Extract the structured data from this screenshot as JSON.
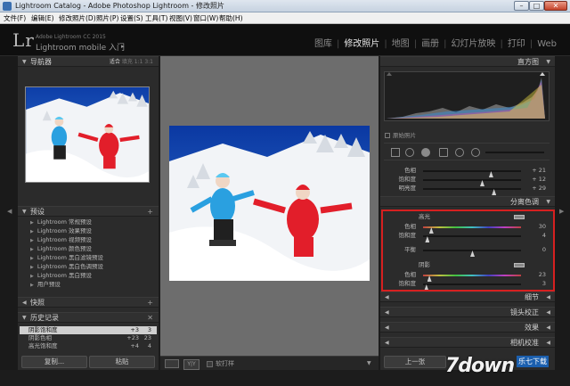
{
  "window": {
    "title": "Lightroom Catalog - Adobe Photoshop Lightroom - 修改照片",
    "min": "–",
    "max": "□",
    "close": "✕"
  },
  "menu": [
    "文件(F)",
    "编辑(E)",
    "修改照片(D)",
    "照片(P)",
    "设置(S)",
    "工具(T)",
    "视图(V)",
    "窗口(W)",
    "帮助(H)"
  ],
  "identity": {
    "logo": "Lr",
    "product": "Adobe Lightroom CC 2015",
    "mobile": "Lightroom mobile 入门",
    "arrow": "▸"
  },
  "modules": [
    "图库",
    "修改照片",
    "地图",
    "画册",
    "幻灯片放映",
    "打印",
    "Web"
  ],
  "active_module": "修改照片",
  "left": {
    "navigator": {
      "label": "导航器",
      "opts": [
        "适合",
        "填充",
        "1:1",
        "3:1"
      ]
    },
    "presets_label": "预设",
    "presets": [
      "Lightroom 常规预设",
      "Lightroom 效果预设",
      "Lightroom 视频预设",
      "Lightroom 颜色预设",
      "Lightroom 黑白滤镜预设",
      "Lightroom 黑白色调预设",
      "Lightroom 黑白预设",
      "用户预设"
    ],
    "snapshots_label": "快照",
    "history_label": "历史记录",
    "history": [
      {
        "name": "阴影饱和度",
        "v1": "+3",
        "v2": "3"
      },
      {
        "name": "阴影色相",
        "v1": "+23",
        "v2": "23"
      },
      {
        "name": "高光饱和度",
        "v1": "+4",
        "v2": "4"
      }
    ],
    "btn_copy": "复制...",
    "btn_paste": "粘贴",
    "plus": "+",
    "close_x": "✕"
  },
  "toolbar": {
    "soft_proof": "软打样",
    "yy": "Y|Y"
  },
  "right": {
    "histogram_label": "直方图",
    "original_photo": "原始照片",
    "hsl_rows": [
      {
        "label": "色相",
        "value": "+ 21",
        "pos": 0.69
      },
      {
        "label": "饱和度",
        "value": "+ 12",
        "pos": 0.6
      },
      {
        "label": "明亮度",
        "value": "+ 29",
        "pos": 0.72
      }
    ],
    "split_toning_label": "分离色调",
    "highlights_label": "高光",
    "highlight_rows": [
      {
        "label": "色相",
        "value": "30",
        "pos": 0.08
      },
      {
        "label": "饱和度",
        "value": "4",
        "pos": 0.04
      }
    ],
    "balance": {
      "label": "平衡",
      "value": "0",
      "pos": 0.5
    },
    "shadows_label": "阴影",
    "shadow_rows": [
      {
        "label": "色相",
        "value": "23",
        "pos": 0.06
      },
      {
        "label": "饱和度",
        "value": "3",
        "pos": 0.03
      }
    ],
    "sections": [
      "细节",
      "镜头校正",
      "效果",
      "相机校准"
    ],
    "btn_prev": "上一张"
  },
  "watermark": {
    "logo": "7down",
    "cn": "乐七下载"
  }
}
